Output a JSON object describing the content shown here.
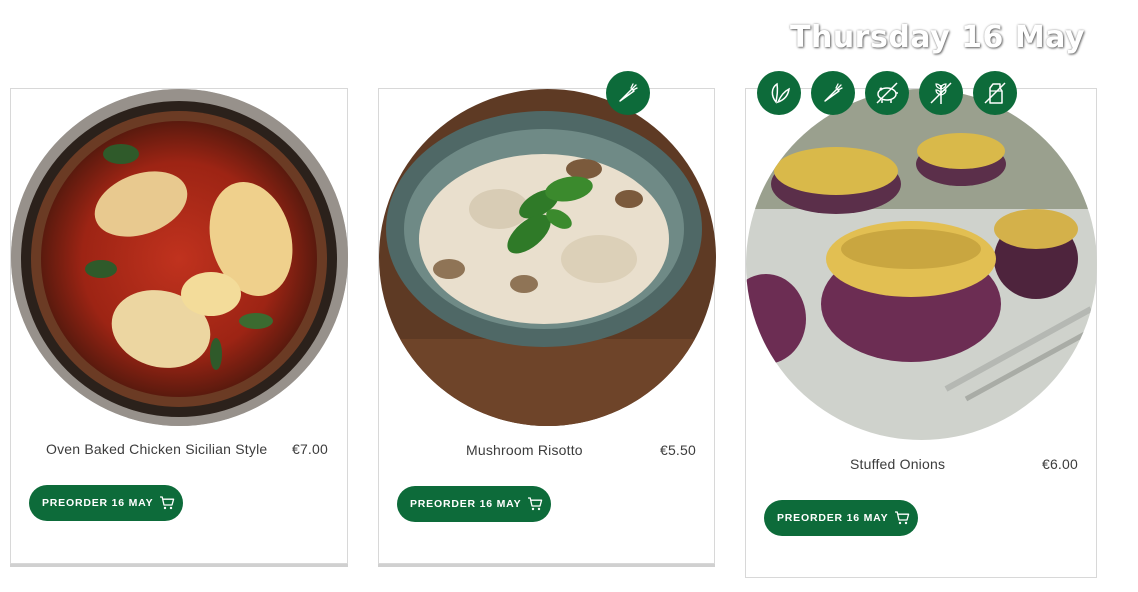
{
  "date_heading": "Thursday 16 May",
  "colors": {
    "brand_green": "#0d6b3a",
    "card_border": "#d8d8d8",
    "text": "#3c3c3c"
  },
  "dishes": [
    {
      "name": "Oven Baked Chicken Sicilian Style",
      "price": "€7.00",
      "preorder_label": "PREORDER 16 MAY",
      "icons": []
    },
    {
      "name": "Mushroom Risotto",
      "price": "€5.50",
      "preorder_label": "PREORDER 16 MAY",
      "icons": [
        "vegetarian-carrot-icon"
      ]
    },
    {
      "name": "Stuffed Onions",
      "price": "€6.00",
      "preorder_label": "PREORDER 16 MAY",
      "icons": [
        "vegan-leaf-icon",
        "vegetarian-carrot-icon",
        "no-pork-icon",
        "gluten-free-icon",
        "dairy-free-icon"
      ]
    }
  ]
}
